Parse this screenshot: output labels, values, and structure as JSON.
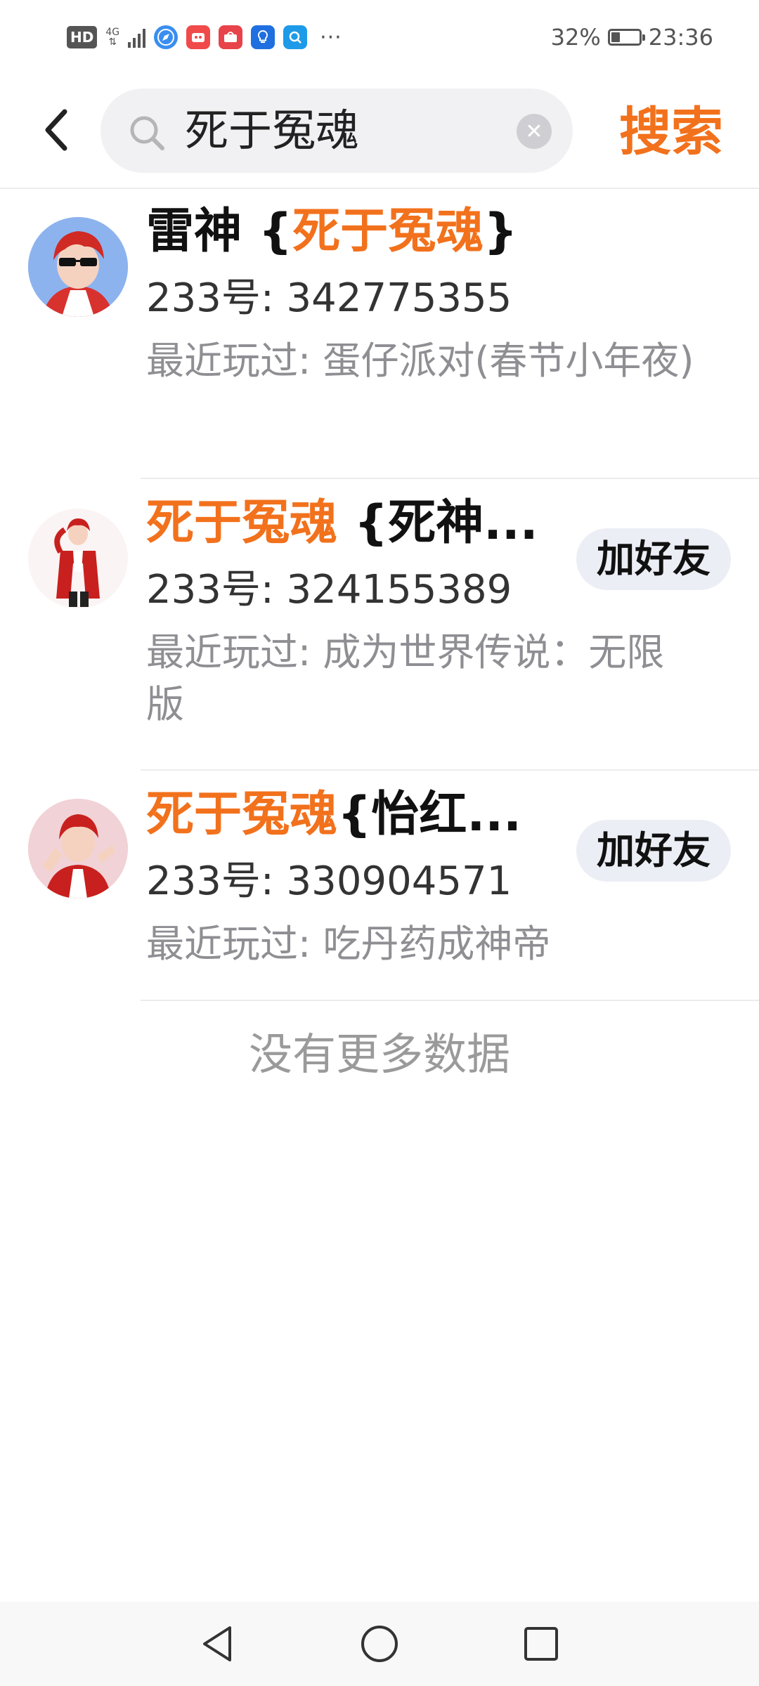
{
  "status_bar": {
    "hd": "HD",
    "network": "4G",
    "battery_percent": "32%",
    "battery_level": 0.32,
    "time": "23:36",
    "app_icons": [
      "compass-app-icon",
      "video-app-icon",
      "huawei-app-icon",
      "bulb-app-icon",
      "search-app-icon"
    ],
    "more": "···"
  },
  "header": {
    "search_value": "死于冤魂",
    "search_button_label": "搜索",
    "accent_color": "#f2711c"
  },
  "results": [
    {
      "name_prefix": "雷神 {",
      "name_highlight": "死于冤魂",
      "name_suffix": "}",
      "uid": "233号: 342775355",
      "recent": "最近玩过: 蛋仔派对(春节小年夜)",
      "add_label": ""
    },
    {
      "name_prefix": "",
      "name_highlight": "死于冤魂",
      "name_suffix": " {死神...",
      "uid": "233号: 324155389",
      "recent": "最近玩过: 成为世界传说：无限版",
      "add_label": "加好友"
    },
    {
      "name_prefix": "",
      "name_highlight": "死于冤魂",
      "name_suffix": "{怡红...",
      "uid": "233号: 330904571",
      "recent": "最近玩过: 吃丹药成神帝",
      "add_label": "加好友"
    }
  ],
  "no_more_text": "没有更多数据"
}
